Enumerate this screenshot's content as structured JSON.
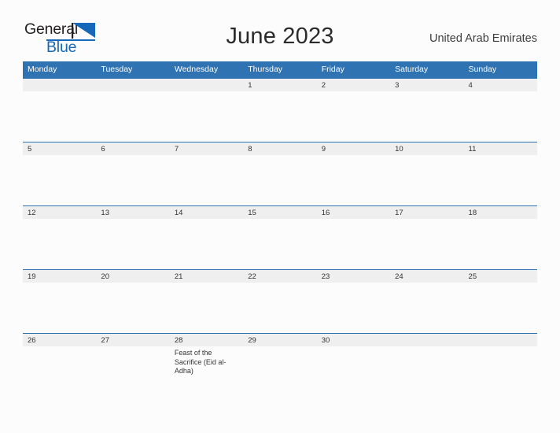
{
  "brand": {
    "word1": "General",
    "word2": "Blue",
    "flag_icon": "blue-flag-triangle",
    "accent_color": "#1569b8"
  },
  "header": {
    "month_title": "June 2023",
    "country": "United Arab Emirates"
  },
  "calendar": {
    "header_bg": "#2f73b2",
    "datebar_bg": "#efeff0",
    "weekday_headers": [
      "Monday",
      "Tuesday",
      "Wednesday",
      "Thursday",
      "Friday",
      "Saturday",
      "Sunday"
    ],
    "weeks": [
      [
        {
          "date": "",
          "events": []
        },
        {
          "date": "",
          "events": []
        },
        {
          "date": "",
          "events": []
        },
        {
          "date": "1",
          "events": []
        },
        {
          "date": "2",
          "events": []
        },
        {
          "date": "3",
          "events": []
        },
        {
          "date": "4",
          "events": []
        }
      ],
      [
        {
          "date": "5",
          "events": []
        },
        {
          "date": "6",
          "events": []
        },
        {
          "date": "7",
          "events": []
        },
        {
          "date": "8",
          "events": []
        },
        {
          "date": "9",
          "events": []
        },
        {
          "date": "10",
          "events": []
        },
        {
          "date": "11",
          "events": []
        }
      ],
      [
        {
          "date": "12",
          "events": []
        },
        {
          "date": "13",
          "events": []
        },
        {
          "date": "14",
          "events": []
        },
        {
          "date": "15",
          "events": []
        },
        {
          "date": "16",
          "events": []
        },
        {
          "date": "17",
          "events": []
        },
        {
          "date": "18",
          "events": []
        }
      ],
      [
        {
          "date": "19",
          "events": []
        },
        {
          "date": "20",
          "events": []
        },
        {
          "date": "21",
          "events": []
        },
        {
          "date": "22",
          "events": []
        },
        {
          "date": "23",
          "events": []
        },
        {
          "date": "24",
          "events": []
        },
        {
          "date": "25",
          "events": []
        }
      ],
      [
        {
          "date": "26",
          "events": []
        },
        {
          "date": "27",
          "events": []
        },
        {
          "date": "28",
          "events": [
            "Feast of the Sacrifice (Eid al-Adha)"
          ]
        },
        {
          "date": "29",
          "events": []
        },
        {
          "date": "30",
          "events": []
        },
        {
          "date": "",
          "events": []
        },
        {
          "date": "",
          "events": []
        }
      ]
    ]
  }
}
